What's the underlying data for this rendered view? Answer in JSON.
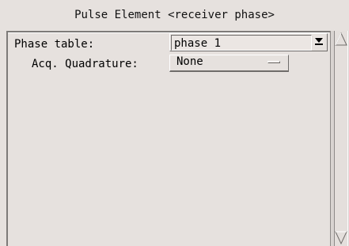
{
  "window": {
    "title": "Pulse Element <receiver phase>"
  },
  "form": {
    "phase_table_label": "Phase table:",
    "phase_table_value": "phase 1",
    "acq_quadrature_label": "Acq. Quadrature:",
    "acq_quadrature_value": "None"
  },
  "icons": {
    "combo_dropdown": "dropdown-arrow-icon",
    "option_menu": "option-menu-indicator-icon",
    "scroll_up": "arrow-up-icon",
    "scroll_down": "arrow-down-icon"
  },
  "colors": {
    "background": "#e6e1de",
    "shadow": "#6f6c6a",
    "highlight": "#ffffff"
  }
}
